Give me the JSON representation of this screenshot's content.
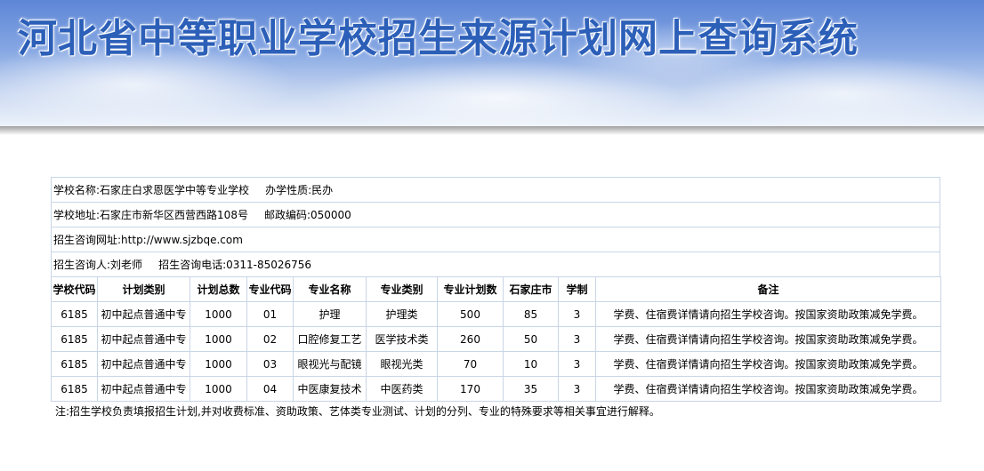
{
  "banner": {
    "title": "河北省中等职业学校招生来源计划网上查询系统"
  },
  "info": {
    "school_name_label": "学校名称:",
    "school_name": "石家庄白求恩医学中等专业学校",
    "nature_label": "办学性质:",
    "nature": "民办",
    "address_label": "学校地址:",
    "address": "石家庄市新华区西营西路108号",
    "postcode_label": "邮政编码:",
    "postcode": "050000",
    "website_label": "招生咨询网址:",
    "website": "http://www.sjzbqe.com",
    "contact_label": "招生咨询人:",
    "contact": "刘老师",
    "phone_label": "招生咨询电话:",
    "phone": "0311-85026756"
  },
  "table": {
    "headers": [
      "学校代码",
      "计划类别",
      "计划总数",
      "专业代码",
      "专业名称",
      "专业类别",
      "专业计划数",
      "石家庄市",
      "学制",
      "备注"
    ],
    "rows": [
      [
        "6185",
        "初中起点普通中专",
        "1000",
        "01",
        "护理",
        "护理类",
        "500",
        "85",
        "3",
        "学费、住宿费详情请向招生学校咨询。按国家资助政策减免学费。"
      ],
      [
        "6185",
        "初中起点普通中专",
        "1000",
        "02",
        "口腔修复工艺",
        "医学技术类",
        "260",
        "50",
        "3",
        "学费、住宿费详情请向招生学校咨询。按国家资助政策减免学费。"
      ],
      [
        "6185",
        "初中起点普通中专",
        "1000",
        "03",
        "眼视光与配镜",
        "眼视光类",
        "70",
        "10",
        "3",
        "学费、住宿费详情请向招生学校咨询。按国家资助政策减免学费。"
      ],
      [
        "6185",
        "初中起点普通中专",
        "1000",
        "04",
        "中医康复技术",
        "中医药类",
        "170",
        "35",
        "3",
        "学费、住宿费详情请向招生学校咨询。按国家资助政策减免学费。"
      ]
    ]
  },
  "note": "注:招生学校负责填报招生计划,并对收费标准、资助政策、艺体类专业测试、计划的分列、专业的特殊要求等相关事宜进行解释。"
}
